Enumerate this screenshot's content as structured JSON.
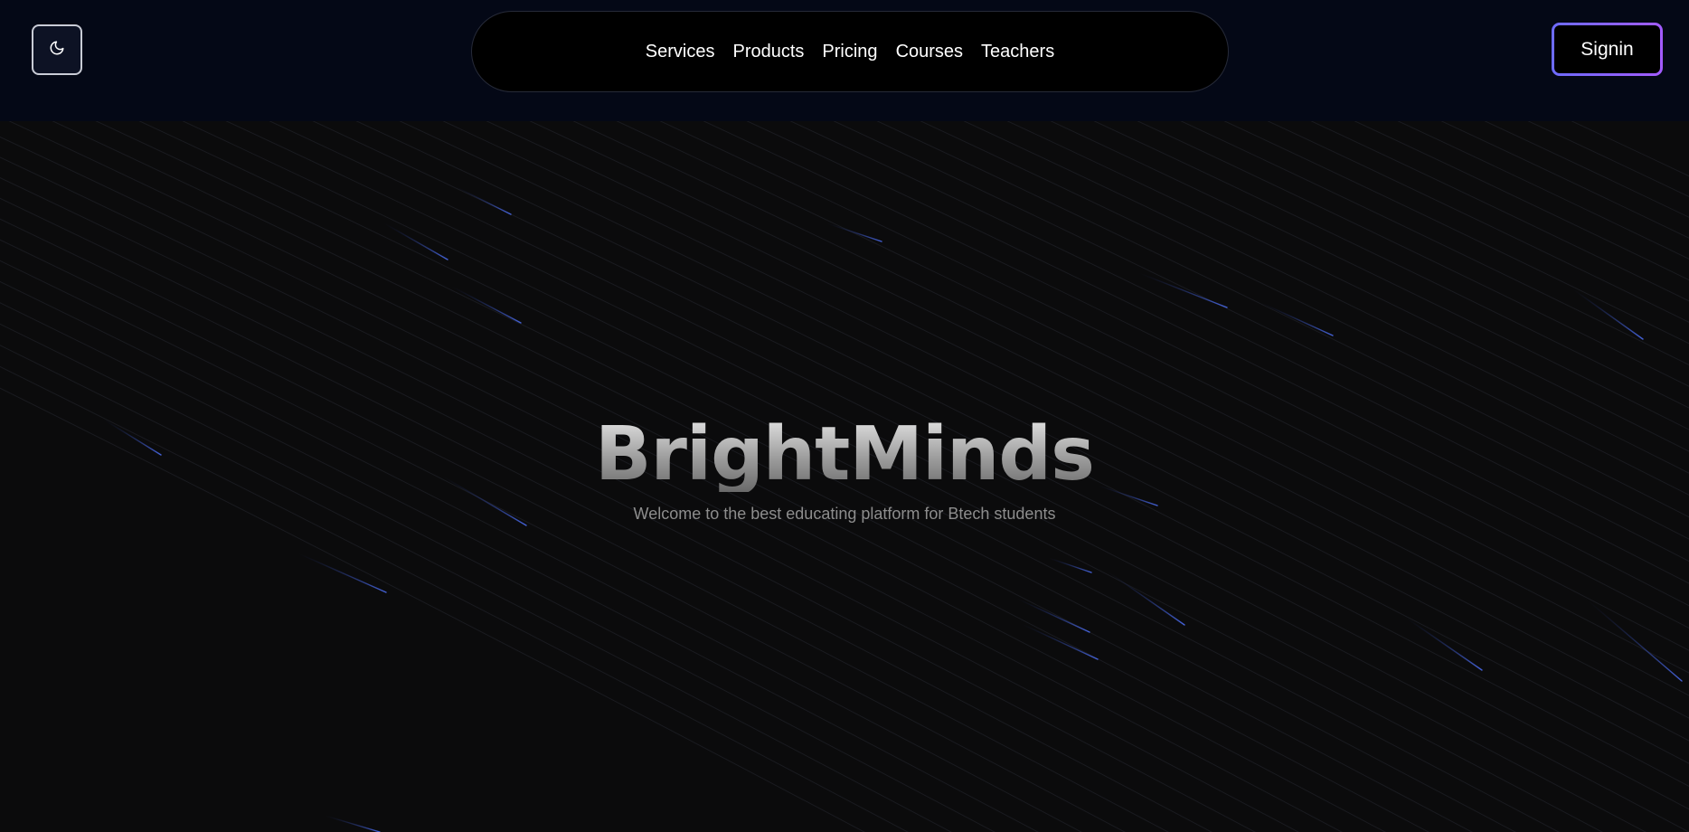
{
  "header": {
    "theme_toggle_icon": "moon-icon",
    "nav": [
      "Services",
      "Products",
      "Pricing",
      "Courses",
      "Teachers"
    ],
    "signin_label": "Signin"
  },
  "hero": {
    "title": "BrightMinds",
    "subtitle": "Welcome to the best educating platform for Btech students"
  },
  "colors": {
    "header_bg": "#040816",
    "page_bg": "#0b0b0c",
    "accent_start": "#6d6bff",
    "accent_end": "#a35bff",
    "beam": "#3b5bdb"
  }
}
